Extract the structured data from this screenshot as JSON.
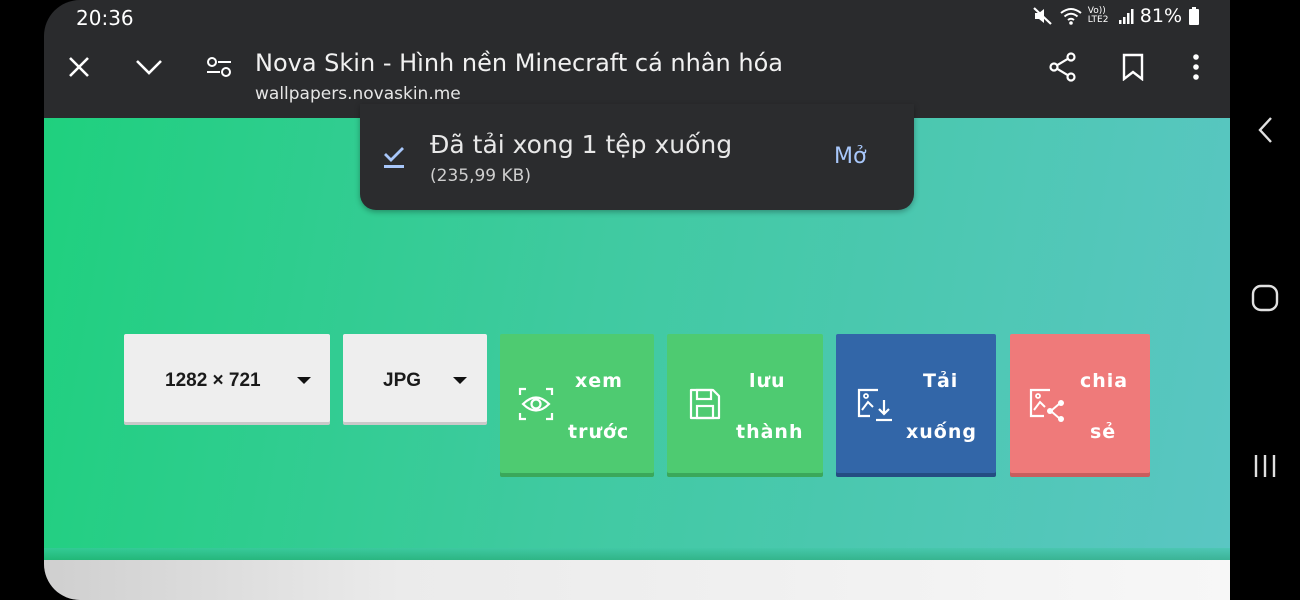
{
  "status_bar": {
    "time": "20:36",
    "network_label": "Vo)) LTE2",
    "battery": "81%",
    "icons": [
      "mute-icon",
      "wifi-icon",
      "signal-icon",
      "battery-icon"
    ]
  },
  "toolbar": {
    "title": "Nova Skin - Hình nền Minecraft cá nhân hóa",
    "url": "wallpapers.novaskin.me",
    "icons": [
      "close-icon",
      "chevron-down-icon",
      "site-settings-icon",
      "share-icon",
      "bookmark-icon",
      "more-vert-icon"
    ]
  },
  "download_toast": {
    "title": "Đã tải xong 1 tệp xuống",
    "size": "(235,99 KB)",
    "open_label": "Mở",
    "accent_color": "#a8c7fa"
  },
  "controls": {
    "resolution": "1282 × 721",
    "format": "JPG",
    "buttons": [
      {
        "line1": "xem",
        "line2": "trước",
        "color": "#4ecb71",
        "icon": "eye-scan-icon"
      },
      {
        "line1": "lưu",
        "line2": "thành",
        "color": "#4ecb71",
        "icon": "save-icon"
      },
      {
        "line1": "Tải",
        "line2": "xuống",
        "color": "#3266a8",
        "icon": "image-download-icon"
      },
      {
        "line1": "chia",
        "line2": "sẻ",
        "color": "#ef7a7a",
        "icon": "image-share-icon"
      }
    ]
  },
  "nav_bar": {
    "icons": [
      "back-icon",
      "home-icon",
      "recents-icon"
    ]
  },
  "colors": {
    "gradient_start": "#1fd07e",
    "gradient_end": "#5ac6c3",
    "toolbar_bg": "#2a2b2d"
  }
}
